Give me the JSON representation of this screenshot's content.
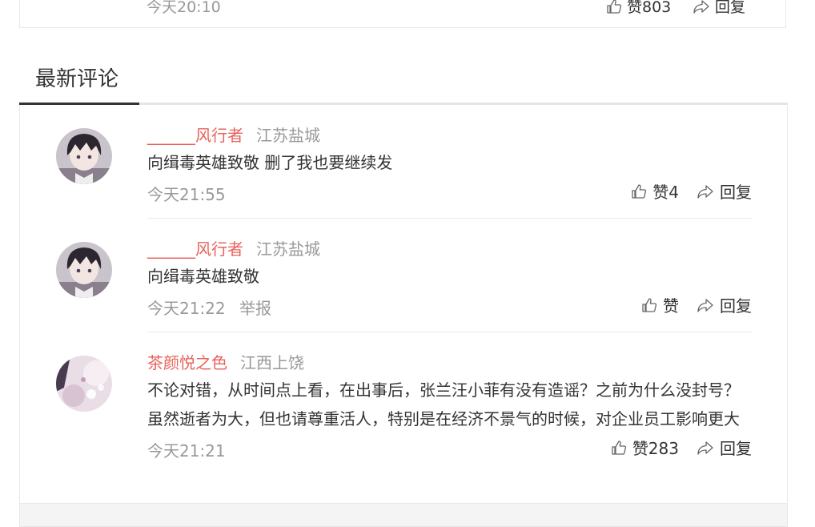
{
  "prev_comment": {
    "time": "今天20:10",
    "like_label": "赞803",
    "reply_label": "回复"
  },
  "section": {
    "title": "最新评论"
  },
  "comments": [
    {
      "name": "______风行者",
      "location": "江苏盐城",
      "content": "向缉毒英雄致敬 删了我也要继续发",
      "time": "今天21:55",
      "like_label": "赞4",
      "reply_label": "回复"
    },
    {
      "name": "______风行者",
      "location": "江苏盐城",
      "content": "向缉毒英雄致敬",
      "time": "今天21:22",
      "report_label": "举报",
      "like_label": "赞",
      "reply_label": "回复"
    },
    {
      "name": "茶颜悦之色",
      "location": "江西上饶",
      "content": "不论对错，从时间点上看，在出事后，张兰汪小菲有没有造谣？之前为什么没封号？虽然逝者为大，但也请尊重活人，特别是在经济不景气的时候，对企业员工影响更大",
      "time": "今天21:21",
      "like_label": "赞283",
      "reply_label": "回复"
    }
  ],
  "colors": {
    "name": "#e8625b",
    "meta": "#999999",
    "text": "#333333"
  },
  "icons": {
    "like": "thumbs-up-icon",
    "reply": "reply-arrow-icon"
  }
}
